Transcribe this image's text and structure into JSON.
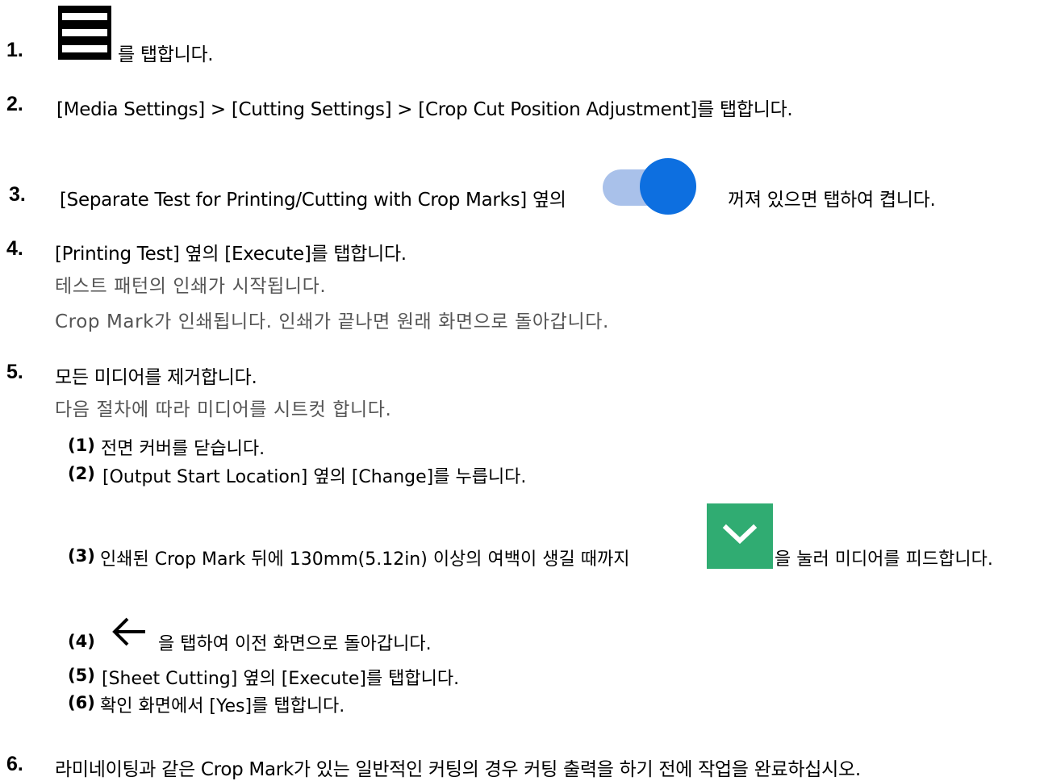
{
  "steps": {
    "s1": {
      "num": "1.",
      "text": "를 탭합니다."
    },
    "s2": {
      "num": "2.",
      "text": "[Media Settings] > [Cutting Settings] > [Crop Cut Position Adjustment]를 탭합니다."
    },
    "s3": {
      "num": "3.",
      "text_before": "[Separate Test for Printing/Cutting with Crop Marks] 옆의",
      "text_after": "꺼져 있으면 탭하여 켭니다."
    },
    "s4": {
      "num": "4.",
      "text": "[Printing Test] 옆의 [Execute]를 탭합니다.",
      "sub1": "테스트 패턴의 인쇄가 시작됩니다.",
      "sub2": "Crop Mark가 인쇄됩니다. 인쇄가 끝나면 원래 화면으로 돌아갑니다."
    },
    "s5": {
      "num": "5.",
      "text": "모든 미디어를 제거합니다.",
      "sub": "다음 절차에 따라 미디어를 시트컷 합니다.",
      "items": [
        {
          "num": "(1)",
          "text": "전면 커버를 닫습니다."
        },
        {
          "num": "(2)",
          "text": "[Output Start Location] 옆의 [Change]를 누릅니다."
        },
        {
          "num": "(3)",
          "text_before": "인쇄된 Crop Mark 뒤에 130mm(5.12in) 이상의 여백이 생길 때까지",
          "text_after": "을 눌러 미디어를 피드합니다."
        },
        {
          "num": "(4)",
          "text": "을 탭하여 이전 화면으로 돌아갑니다."
        },
        {
          "num": "(5)",
          "text": "[Sheet Cutting] 옆의 [Execute]를 탭합니다."
        },
        {
          "num": "(6)",
          "text": "확인 화면에서 [Yes]를 탭합니다."
        }
      ]
    },
    "s6": {
      "num": "6.",
      "text": "라미네이팅과 같은 Crop Mark가 있는 일반적인 커팅의 경우 커팅 출력을 하기 전에 작업을 완료하십시오."
    }
  },
  "icons": {
    "menu": "menu-icon",
    "toggle": "toggle-switch-on-icon",
    "feed": "chevron-down-icon",
    "back": "arrow-left-icon"
  },
  "colors": {
    "toggle_track": "#a9c1ea",
    "toggle_knob": "#0d6fe0",
    "feed_button": "#30ac72",
    "sub_text": "#555555"
  }
}
